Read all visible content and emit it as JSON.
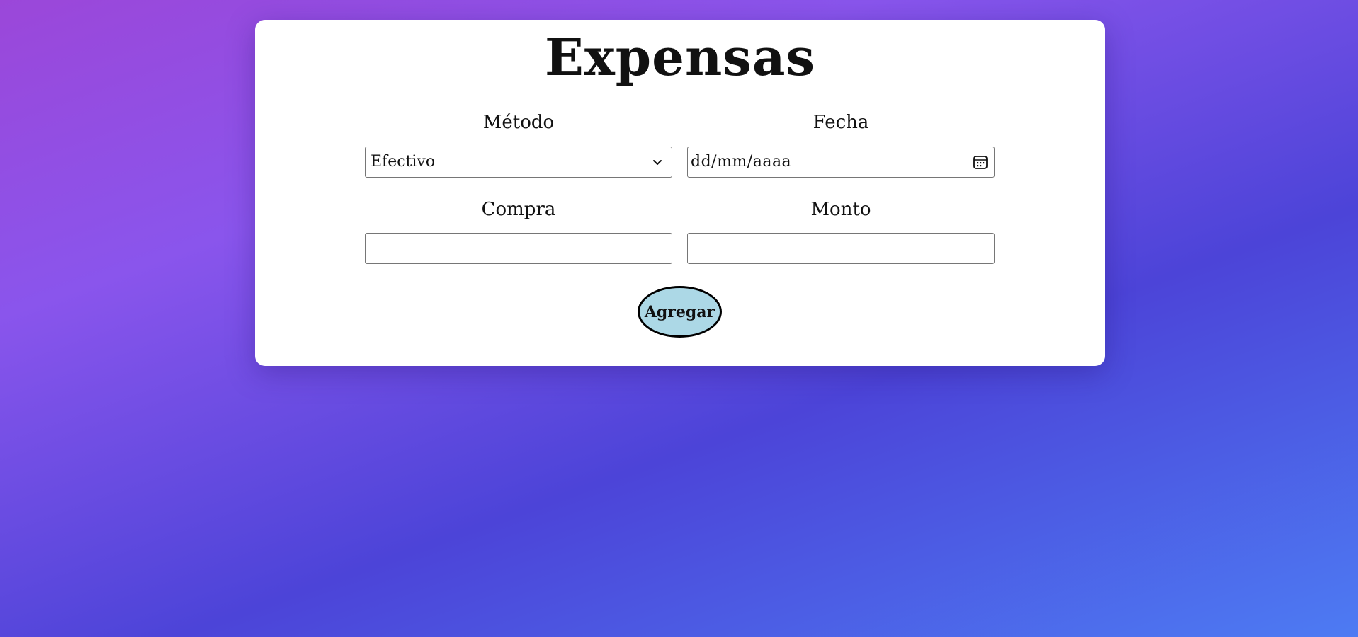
{
  "title": "Expensas",
  "form": {
    "method": {
      "label": "Método",
      "selected": "Efectivo"
    },
    "date": {
      "label": "Fecha",
      "placeholder": "dd/mm/aaaa"
    },
    "purchase": {
      "label": "Compra",
      "value": ""
    },
    "amount": {
      "label": "Monto",
      "value": ""
    },
    "submit_label": "Agregar"
  },
  "icons": {
    "select_arrow": "chevron-down-icon",
    "date_picker": "calendar-icon"
  },
  "colors": {
    "button_background": "#acd8e6",
    "card_background": "#ffffff",
    "gradient_start": "#9b47d9",
    "gradient_end": "#4d7bf3"
  }
}
